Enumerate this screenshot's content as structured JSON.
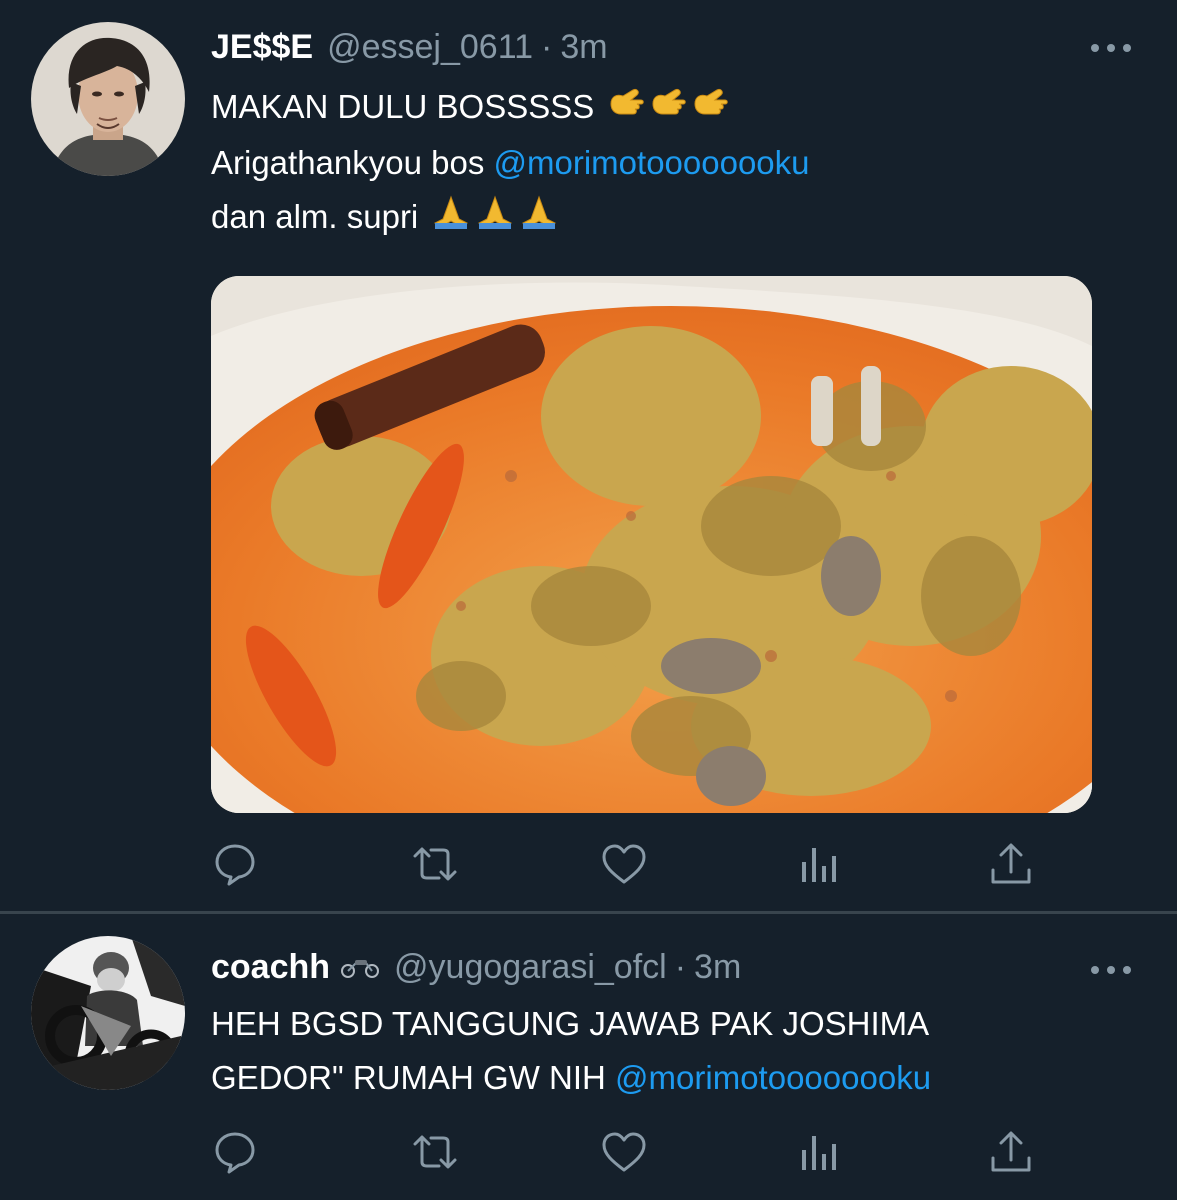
{
  "tweets": [
    {
      "author": {
        "name": "JE$$E",
        "handle": "@essej_0611",
        "time": "3m"
      },
      "lines": [
        {
          "text": "MAKAN DULU BOSSSSS",
          "emoji": "call-me-hand x3"
        },
        {
          "text": "Arigathankyou bos ",
          "mention": "@morimotoooooooku"
        },
        {
          "text": "dan alm. supri",
          "emoji": "folded-hands x3"
        }
      ],
      "media": {
        "kind": "photo",
        "subject": "curry stew"
      },
      "actions": [
        "reply-icon",
        "retweet-icon",
        "like-icon",
        "analytics-icon",
        "share-icon"
      ]
    },
    {
      "author": {
        "name": "coachh",
        "name_emoji": "motorcycle",
        "handle": "@yugogarasi_ofcl",
        "time": "3m"
      },
      "lines": [
        {
          "text": "HEH BGSD TANGGUNG JAWAB PAK JOSHIMA"
        },
        {
          "text": "GEDOR\" RUMAH GW NIH ",
          "mention": "@morimotoooooooku"
        }
      ],
      "actions": [
        "reply-icon",
        "retweet-icon",
        "like-icon",
        "analytics-icon",
        "share-icon"
      ]
    }
  ],
  "colors": {
    "background": "#15202b",
    "text": "#ffffff",
    "secondary": "#8899a6",
    "link": "#1d9bf0",
    "divider": "#38444d"
  }
}
